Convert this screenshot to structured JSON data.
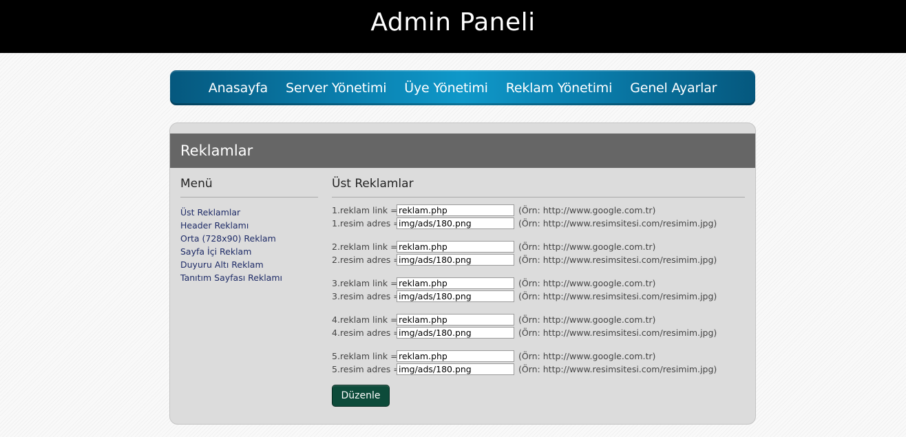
{
  "header": {
    "title": "Admin Paneli"
  },
  "nav": {
    "items": [
      {
        "label": "Anasayfa"
      },
      {
        "label": "Server Yönetimi"
      },
      {
        "label": "Üye Yönetimi"
      },
      {
        "label": "Reklam Yönetimi"
      },
      {
        "label": "Genel Ayarlar"
      }
    ]
  },
  "panel": {
    "title": "Reklamlar"
  },
  "sidebar": {
    "title": "Menü",
    "items": [
      {
        "label": "Üst Reklamlar"
      },
      {
        "label": "Header Reklamı"
      },
      {
        "label": "Orta (728x90) Reklam"
      },
      {
        "label": "Sayfa İçi Reklam"
      },
      {
        "label": "Duyuru Altı Reklam"
      },
      {
        "label": "Tanıtım Sayfası Reklamı"
      }
    ]
  },
  "main": {
    "title": "Üst Reklamlar",
    "ads": [
      {
        "link_label": "1.reklam link =",
        "link_value": "reklam.php",
        "link_example": "(Örn: http://www.google.com.tr)",
        "img_label": "1.resim adres =",
        "img_value": "img/ads/180.png",
        "img_example": "(Örn: http://www.resimsitesi.com/resimim.jpg)"
      },
      {
        "link_label": "2.reklam link =",
        "link_value": "reklam.php",
        "link_example": "(Örn: http://www.google.com.tr)",
        "img_label": "2.resim adres =",
        "img_value": "img/ads/180.png",
        "img_example": "(Örn: http://www.resimsitesi.com/resimim.jpg)"
      },
      {
        "link_label": "3.reklam link =",
        "link_value": "reklam.php",
        "link_example": "(Örn: http://www.google.com.tr)",
        "img_label": "3.resim adres =",
        "img_value": "img/ads/180.png",
        "img_example": "(Örn: http://www.resimsitesi.com/resimim.jpg)"
      },
      {
        "link_label": "4.reklam link =",
        "link_value": "reklam.php",
        "link_example": "(Örn: http://www.google.com.tr)",
        "img_label": "4.resim adres =",
        "img_value": "img/ads/180.png",
        "img_example": "(Örn: http://www.resimsitesi.com/resimim.jpg)"
      },
      {
        "link_label": "5.reklam link =",
        "link_value": "reklam.php",
        "link_example": "(Örn: http://www.google.com.tr)",
        "img_label": "5.resim adres =",
        "img_value": "img/ads/180.png",
        "img_example": "(Örn: http://www.resimsitesi.com/resimim.jpg)"
      }
    ],
    "submit_label": "Düzenle"
  },
  "colors": {
    "header_bg": "#000000",
    "nav_accent": "#0f98c9",
    "panel_bg": "#dcdcdc",
    "panel_head_bg": "#666666",
    "link_color": "#1d2a66",
    "button_bg": "#0d4b3a"
  }
}
